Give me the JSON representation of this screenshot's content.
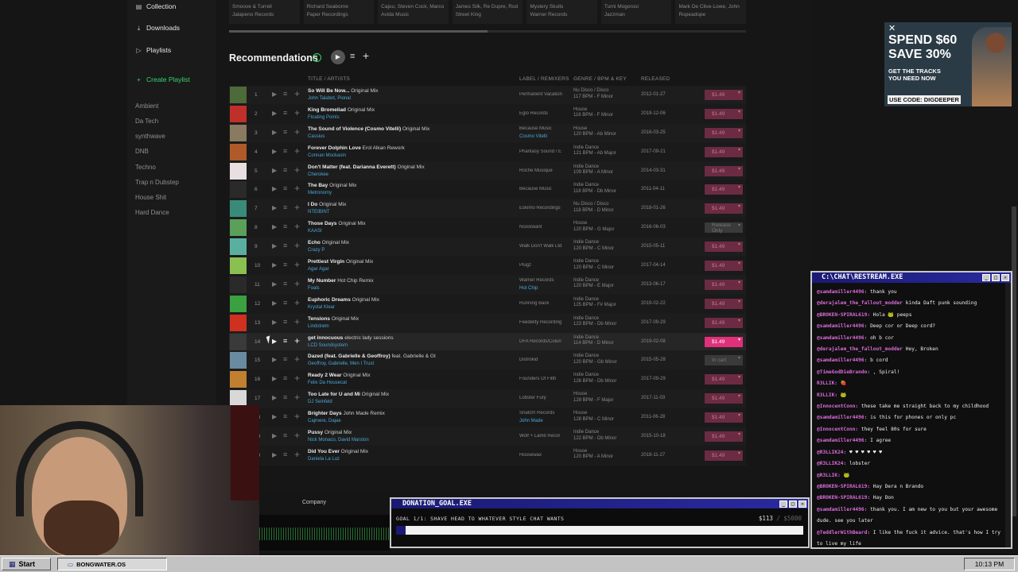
{
  "sidebar": {
    "collection": "Collection",
    "downloads": "Downloads",
    "playlists": "Playlists",
    "create_playlist": "Create Playlist",
    "genres": [
      "Ambient",
      "Da Tech",
      "synthwave",
      "DNB",
      "Techno",
      "Trap n Dubstep",
      "House Shit",
      "Hard Dance"
    ]
  },
  "top_strip": [
    [
      "Smoove & Turrell",
      "Jalapeno Records"
    ],
    [
      "Richard Seaborne",
      "Paper Recordings"
    ],
    [
      "Cajuu, Steven Cock, Marco",
      "Avida Music"
    ],
    [
      "James Silk, Re Dupre, Rod",
      "Street King"
    ],
    [
      "Mystery Skulls",
      "Warner Records"
    ],
    [
      "Turni Mogorosi",
      "Jazzman"
    ],
    [
      "Mark De Clive-Lowe, John",
      "Ropeadope"
    ]
  ],
  "recommendations": {
    "title": "Recommendations",
    "columns": {
      "title": "TITLE / ARTISTS",
      "label": "LABEL / REMIXERS",
      "genre": "GENRE / BPM & KEY",
      "released": "RELEASED"
    },
    "tracks": [
      {
        "n": "1",
        "title": "So Will Be Now...",
        "mix": "Original Mix",
        "artists": "John Talabot, Pional",
        "label": "Permanent Vacation",
        "remixer": "",
        "genre": "Nu Disco / Disco",
        "bpm": "117 BPM - F Minor",
        "released": "2012-01-27",
        "price": "$1.49",
        "art": "#4d6a3a",
        "dim": true
      },
      {
        "n": "2",
        "title": "King Bromeliad",
        "mix": "Original Mix",
        "artists": "Floating Points",
        "label": "Eglo Records",
        "remixer": "",
        "genre": "House",
        "bpm": "116 BPM - F Minor",
        "released": "2019-12-06",
        "price": "$1.49",
        "art": "#c0302a",
        "dim": true
      },
      {
        "n": "3",
        "title": "The Sound of Violence (Cosmo Vitelli)",
        "mix": "Original Mix",
        "artists": "Cassius",
        "label": "Because Music",
        "remixer": "Cosmo Vitelli",
        "genre": "House",
        "bpm": "120 BPM - Ab Minor",
        "released": "2016-03-25",
        "price": "$1.49",
        "art": "#8a7a60",
        "dim": true
      },
      {
        "n": "4",
        "title": "Forever Dolphin Love",
        "mix": "Erol Alkan Rework",
        "artists": "Connan Mockasin",
        "label": "Phantasy Sound / E",
        "remixer": "",
        "genre": "Indie Dance",
        "bpm": "121 BPM - Ab Major",
        "released": "2017-09-21",
        "price": "$1.49",
        "art": "#b05a2a",
        "dim": true
      },
      {
        "n": "5",
        "title": "Don't Matter (feat. Darianna Everett)",
        "mix": "Original Mix",
        "artists": "Cherokee",
        "label": "Roche Musique",
        "remixer": "",
        "genre": "Indie Dance",
        "bpm": "109 BPM - A Minor",
        "released": "2014-03-31",
        "price": "$1.49",
        "art": "#e8e0e0",
        "dim": true
      },
      {
        "n": "6",
        "title": "The Bay",
        "mix": "Original Mix",
        "artists": "Metronomy",
        "label": "Because Music",
        "remixer": "",
        "genre": "Indie Dance",
        "bpm": "118 BPM - Db Minor",
        "released": "2011-04-11",
        "price": "$1.49",
        "art": "#2a2a2a",
        "dim": true
      },
      {
        "n": "7",
        "title": "I Do",
        "mix": "Original Mix",
        "artists": "NTEIBINT",
        "label": "Eskimo Recordings",
        "remixer": "",
        "genre": "Nu Disco / Disco",
        "bpm": "118 BPM - D Minor",
        "released": "2018-01-26",
        "price": "$1.49",
        "art": "#3a8a7a",
        "dim": true
      },
      {
        "n": "8",
        "title": "Those Days",
        "mix": "Original Mix",
        "artists": "KAASI",
        "label": "Noostwant",
        "remixer": "",
        "genre": "House",
        "bpm": "120 BPM - G Major",
        "released": "2016-06-03",
        "price": "Release Only",
        "art": "#5aa05a",
        "dim": true
      },
      {
        "n": "9",
        "title": "Echo",
        "mix": "Original Mix",
        "artists": "Crazy P",
        "label": "Walk Don't Walk Ltd",
        "remixer": "",
        "genre": "Indie Dance",
        "bpm": "120 BPM - C Minor",
        "released": "2015-05-11",
        "price": "$1.49",
        "art": "#5ab0a0",
        "dim": true
      },
      {
        "n": "10",
        "title": "Prettiest Virgin",
        "mix": "Original Mix",
        "artists": "Agar Agar",
        "label": "Plugz",
        "remixer": "",
        "genre": "Indie Dance",
        "bpm": "120 BPM - C Minor",
        "released": "2017-04-14",
        "price": "$1.49",
        "art": "#8ac050",
        "dim": true
      },
      {
        "n": "11",
        "title": "My Number",
        "mix": "Hot Chip Remix",
        "artists": "Foals",
        "label": "Warner Records",
        "remixer": "Hot Chip",
        "genre": "Indie Dance",
        "bpm": "120 BPM - E Major",
        "released": "2013-06-17",
        "price": "$1.49",
        "art": "#2a2a2a",
        "dim": true
      },
      {
        "n": "12",
        "title": "Euphoric Dreams",
        "mix": "Original Mix",
        "artists": "Krystal Klear",
        "label": "Running Back",
        "remixer": "",
        "genre": "Indie Dance",
        "bpm": "125 BPM - F# Major",
        "released": "2019-02-22",
        "price": "$1.49",
        "art": "#3aa040",
        "dim": true
      },
      {
        "n": "13",
        "title": "Tensions",
        "mix": "Original Mix",
        "artists": "Lindstrøm",
        "label": "Feedelity Recording",
        "remixer": "",
        "genre": "Indie Dance",
        "bpm": "123 BPM - Db Minor",
        "released": "2017-09-29",
        "price": "$1.49",
        "art": "#d03020",
        "dim": true
      },
      {
        "n": "14",
        "title": "get innocuous",
        "mix": "electric lady sessions",
        "artists": "LCD Soundsystem",
        "label": "DFA Records/Colun",
        "remixer": "",
        "genre": "Indie Dance",
        "bpm": "114 BPM - D Minor",
        "released": "2019-02-08",
        "price": "$1.49",
        "art": "#3a3a3a",
        "dim": false
      },
      {
        "n": "15",
        "title": "Dazed (feat. Gabrielle & Geoffroy)",
        "mix": "feat. Gabrielle & Gt",
        "artists": "Geoffroy, Gabrielle, Men I Trust",
        "label": "Distrokid",
        "remixer": "",
        "genre": "Indie Dance",
        "bpm": "120 BPM - Gb Minor",
        "released": "2015-05-28",
        "price": "In cart",
        "art": "#6a8aa0",
        "dim": true
      },
      {
        "n": "16",
        "title": "Ready 2 Wear",
        "mix": "Original Mix",
        "artists": "Felix Da Housecat",
        "label": "Founders Of Filth",
        "remixer": "",
        "genre": "Indie Dance",
        "bpm": "126 BPM - Db Minor",
        "released": "2017-09-29",
        "price": "$1.49",
        "art": "#c08030",
        "dim": true
      },
      {
        "n": "17",
        "title": "Too Late for U and Mi",
        "mix": "Original Mix",
        "artists": "DJ Seinfeld",
        "label": "Lobster Fury",
        "remixer": "",
        "genre": "House",
        "bpm": "128 BPM - F Major",
        "released": "2017-11-03",
        "price": "$1.49",
        "art": "#d8d8d8",
        "dim": true
      },
      {
        "n": "18",
        "title": "Brighter Days",
        "mix": "John Made Remix",
        "artists": "Cajmere, Dajae",
        "label": "Snatch! Records",
        "remixer": "John Made",
        "genre": "House",
        "bpm": "128 BPM - C Minor",
        "released": "2011-06-28",
        "price": "$1.49",
        "art": "#c04040",
        "dim": true
      },
      {
        "n": "19",
        "title": "Pussy",
        "mix": "Original Mix",
        "artists": "Nick Monaco, David Marston",
        "label": "Wolf + Lamb Recor",
        "remixer": "",
        "genre": "Indie Dance",
        "bpm": "122 BPM - Db Minor",
        "released": "2015-10-18",
        "price": "$1.49",
        "art": "#8a6a4a",
        "dim": true
      },
      {
        "n": "20",
        "title": "Did You Ever",
        "mix": "Original Mix",
        "artists": "Daniela La Luz",
        "label": "Housewax",
        "remixer": "",
        "genre": "House",
        "bpm": "120 BPM - A Minor",
        "released": "2018-11-27",
        "price": "$1.49",
        "art": "#3a6a8a",
        "dim": true
      }
    ]
  },
  "footer": {
    "company": "Company"
  },
  "ad": {
    "headline1": "SPEND $60",
    "headline2": "SAVE 30%",
    "sub1": "GET THE TRACKS",
    "sub2": "YOU NEED NOW",
    "code": "USE CODE: DIGDEEPER",
    "close": "✕"
  },
  "chat": {
    "title": "C:\\CHAT\\RESTREAM.EXE",
    "messages": [
      {
        "u": "@samdamiller4496:",
        "c": "#d96bd9",
        "t": "thank you"
      },
      {
        "u": "@derajalem_the_fallout_modder",
        "c": "#d96bd9",
        "t": "kinda Daft punk sounding"
      },
      {
        "u": "@BROKEN-SPIRAL619:",
        "c": "#d96bd9",
        "t": "Hola 🐸 peeps"
      },
      {
        "u": "@samdamiller4496:",
        "c": "#d96bd9",
        "t": "Deep cor or Deep cord?"
      },
      {
        "u": "@samdamiller4496:",
        "c": "#d96bd9",
        "t": "oh b cor"
      },
      {
        "u": "@derajalem_the_fallout_modder",
        "c": "#d96bd9",
        "t": "Hey, Broken"
      },
      {
        "u": "@samdamiller4496:",
        "c": "#d96bd9",
        "t": "b cord"
      },
      {
        "u": "@TimeGodDieBrando:",
        "c": "#d96bd9",
        "t": ", Spiral!"
      },
      {
        "u": "R3LLIK:",
        "c": "#d96bd9",
        "t": "🍓"
      },
      {
        "u": "R3LLIK:",
        "c": "#d96bd9",
        "t": "🐸"
      },
      {
        "u": "@InnocentConn:",
        "c": "#d96bd9",
        "t": "these take me straight back to my childhood"
      },
      {
        "u": "@samdamiller4496:",
        "c": "#d96bd9",
        "t": "is this for phones or only pc"
      },
      {
        "u": "@InnocentConn:",
        "c": "#d96bd9",
        "t": "they feel 80s for sure"
      },
      {
        "u": "@samdamiller4496:",
        "c": "#d96bd9",
        "t": "I agree"
      },
      {
        "u": "@R3LLIK24:",
        "c": "#d96bd9",
        "t": "♥ ♥ ♥ ♥ ♥ ♥"
      },
      {
        "u": "@R3LLIK24:",
        "c": "#d96bd9",
        "t": "lobster"
      },
      {
        "u": "@R3LLIK:",
        "c": "#d96bd9",
        "t": "🐸"
      },
      {
        "u": "@BROKEN-SPIRAL619:",
        "c": "#d96bd9",
        "t": "Hay Dera n Brando"
      },
      {
        "u": "@BROKEN-SPIRAL619:",
        "c": "#d96bd9",
        "t": "Hay Don"
      },
      {
        "u": "@samdamiller4496:",
        "c": "#d96bd9",
        "t": "thank you. I am new to you but your awesome dude. see you later"
      },
      {
        "u": "@TeddlerWithBeard:",
        "c": "#d96bd9",
        "t": "I like the fuck it advice. that's how I try to live my life"
      }
    ]
  },
  "donation": {
    "title": "DONATION_GOAL.EXE",
    "goal": "GOAL 1/1: SHAVE HEAD TO WHATEVER STYLE CHAT WANTS",
    "raised": "$113",
    "target": "/ $5000",
    "progress_fraction": 0.0226,
    "bar_color": "#1a1a74"
  },
  "taskbar": {
    "start": "Start",
    "app": "BONGWATER.OS",
    "clock": "10:13 PM"
  }
}
